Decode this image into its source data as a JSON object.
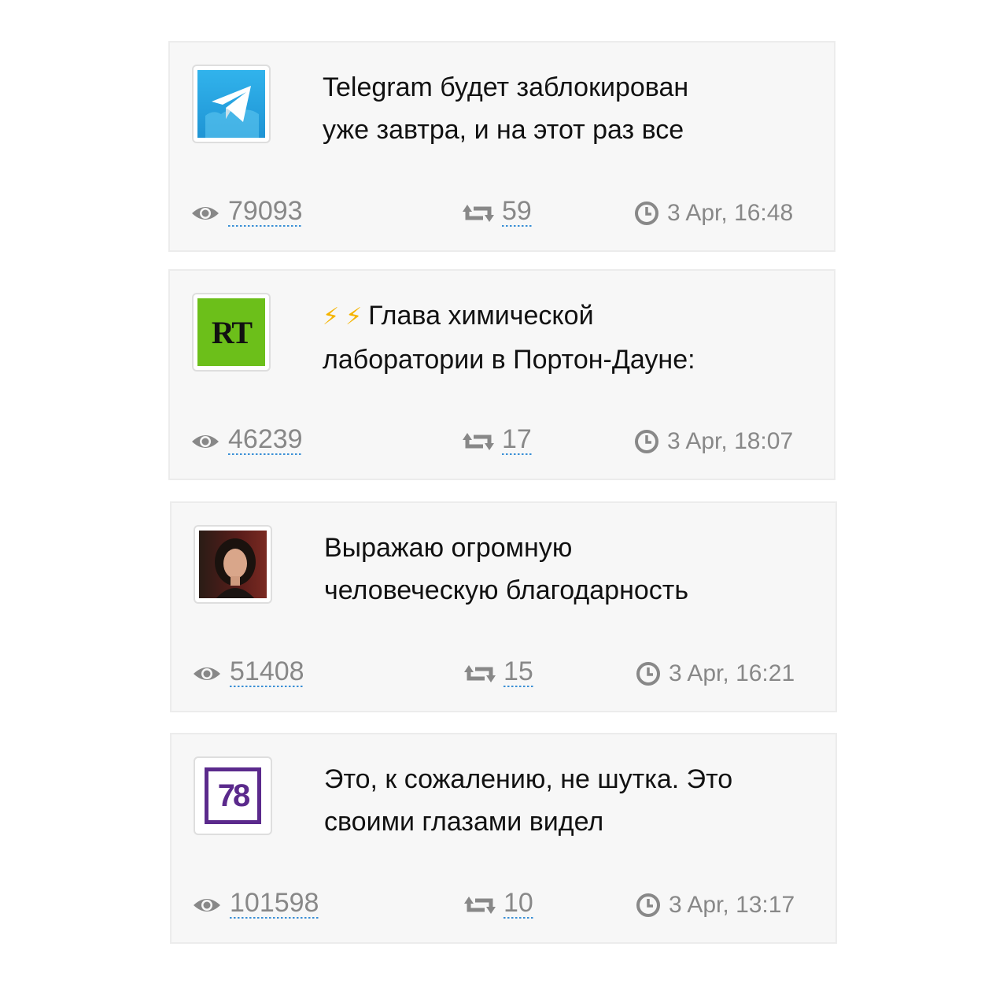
{
  "posts": [
    {
      "channel_icon": "telegram-logo",
      "title_line1": "Telegram будет заблокирован",
      "title_line2": "уже завтра, и на этот раз все",
      "views": "79093",
      "shares": "59",
      "date": "3 Apr, 16:48"
    },
    {
      "channel_icon": "rt-logo",
      "channel_logo_text": "RT",
      "title_prefix_icons": [
        "lightning-icon",
        "lightning-icon"
      ],
      "title_line1": "Глава химической",
      "title_line2": "лаборатории в Портон-Дауне:",
      "views": "46239",
      "shares": "17",
      "date": "3 Apr, 18:07"
    },
    {
      "channel_icon": "person-avatar",
      "title_line1": "Выражаю огромную",
      "title_line2": "человеческую благодарность",
      "views": "51408",
      "shares": "15",
      "date": "3 Apr, 16:21"
    },
    {
      "channel_icon": "channel-78-logo",
      "channel_logo_text": "78",
      "title_line1": "Это, к сожалению, не шутка. Это",
      "title_line2": "своими глазами видел",
      "views": "101598",
      "shares": "10",
      "date": "3 Apr, 13:17"
    }
  ],
  "colors": {
    "card_bg": "#f7f7f7",
    "link_underline": "#3a8fd6",
    "muted_text": "#888888",
    "telegram_blue": "#2aa3e0",
    "rt_green": "#6cbf1a",
    "ch78_purple": "#5b2a8c"
  }
}
